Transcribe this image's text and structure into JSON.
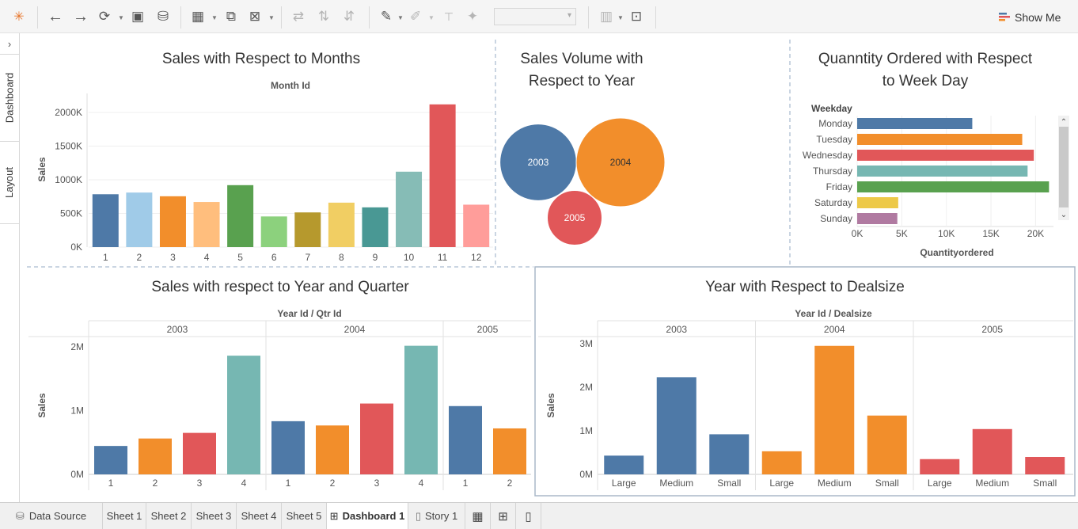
{
  "toolbar": {
    "show_me_label": "Show Me",
    "icons": [
      "tableau-logo-icon",
      "undo-icon",
      "redo-icon",
      "replay-icon",
      "save-icon",
      "new-data-source-icon",
      "new-worksheet-icon",
      "duplicate-icon",
      "clear-sheet-icon",
      "swap-icon",
      "sort-ascending-icon",
      "sort-descending-icon",
      "highlight-icon",
      "annotate-icon",
      "text-label-icon",
      "pin-icon",
      "fit-icon",
      "presentation-icon"
    ]
  },
  "sidebar": {
    "tabs": [
      "Dashboard",
      "Layout"
    ]
  },
  "bottom_tabs": [
    {
      "label": "Data Source",
      "icon": "database-icon"
    },
    {
      "label": "Sheet 1"
    },
    {
      "label": "Sheet 2"
    },
    {
      "label": "Sheet 3"
    },
    {
      "label": "Sheet 4"
    },
    {
      "label": "Sheet 5"
    },
    {
      "label": "Dashboard 1",
      "icon": "dashboard-icon",
      "active": true
    },
    {
      "label": "Story 1",
      "icon": "story-icon"
    }
  ],
  "chart_data": [
    {
      "type": "bar",
      "title": "Sales with Respect to Months",
      "header": "Month Id",
      "ylabel": "Sales",
      "categories": [
        "1",
        "2",
        "3",
        "4",
        "5",
        "6",
        "7",
        "8",
        "9",
        "10",
        "11",
        "12"
      ],
      "values": [
        785000,
        810000,
        755000,
        670000,
        920000,
        455000,
        515000,
        660000,
        590000,
        1120000,
        2120000,
        630000
      ],
      "yticks": [
        {
          "v": 0,
          "label": "0K"
        },
        {
          "v": 500000,
          "label": "500K"
        },
        {
          "v": 1000000,
          "label": "1000K"
        },
        {
          "v": 1500000,
          "label": "1500K"
        },
        {
          "v": 2000000,
          "label": "2000K"
        }
      ],
      "ylim": [
        0,
        2200000
      ],
      "colors": [
        "#4e79a7",
        "#a0cbe8",
        "#f28e2b",
        "#ffbe7d",
        "#59a14f",
        "#8cd17d",
        "#b6992d",
        "#f1ce63",
        "#499894",
        "#86bcb6",
        "#e15759",
        "#ff9d9a"
      ]
    },
    {
      "type": "bubble",
      "title": "Sales Volume  with",
      "title2": "Respect to Year",
      "bubbles": [
        {
          "label": "2003",
          "value": 3520000,
          "color": "#4e79a7"
        },
        {
          "label": "2004",
          "value": 4720000,
          "color": "#f28e2b"
        },
        {
          "label": "2005",
          "value": 1790000,
          "color": "#e15759"
        }
      ]
    },
    {
      "type": "bar",
      "orientation": "horizontal",
      "title": "Quanntity Ordered with Respect",
      "title2": "to Week Day",
      "row_header": "Weekday",
      "xlabel": "Quantityordered",
      "categories": [
        "Monday",
        "Tuesday",
        "Wednesday",
        "Thursday",
        "Friday",
        "Saturday",
        "Sunday"
      ],
      "values": [
        12900,
        18500,
        19800,
        19100,
        21500,
        4600,
        4500
      ],
      "xticks": [
        {
          "v": 0,
          "label": "0K"
        },
        {
          "v": 5000,
          "label": "5K"
        },
        {
          "v": 10000,
          "label": "10K"
        },
        {
          "v": 15000,
          "label": "15K"
        },
        {
          "v": 20000,
          "label": "20K"
        }
      ],
      "xlim": [
        0,
        22000
      ],
      "colors": [
        "#4e79a7",
        "#f28e2b",
        "#e15759",
        "#76b7b2",
        "#59a14f",
        "#edc948",
        "#b07aa1"
      ]
    },
    {
      "type": "bar",
      "title": "Sales with respect to Year and Quarter",
      "header": "Year Id / Qtr Id",
      "ylabel": "Sales",
      "groups": [
        {
          "label": "2003",
          "categories": [
            "1",
            "2",
            "3",
            "4"
          ],
          "values": [
            445000,
            562000,
            650000,
            1860000
          ]
        },
        {
          "label": "2004",
          "categories": [
            "1",
            "2",
            "3",
            "4"
          ],
          "values": [
            833000,
            766000,
            1110000,
            2015000
          ]
        },
        {
          "label": "2005",
          "categories": [
            "1",
            "2"
          ],
          "values": [
            1070000,
            720000
          ]
        }
      ],
      "yticks": [
        {
          "v": 0,
          "label": "0M"
        },
        {
          "v": 1000000,
          "label": "1M"
        },
        {
          "v": 2000000,
          "label": "2M"
        }
      ],
      "ylim": [
        0,
        2060000
      ],
      "colors": [
        "#4e79a7",
        "#f28e2b",
        "#e15759",
        "#76b7b2"
      ]
    },
    {
      "type": "bar",
      "title": "Year with Respect to Dealsize",
      "header": "Year Id / Dealsize",
      "ylabel": "Sales",
      "groups": [
        {
          "label": "2003",
          "categories": [
            "Large",
            "Medium",
            "Small"
          ],
          "values": [
            430000,
            2230000,
            920000
          ],
          "color": "#4e79a7"
        },
        {
          "label": "2004",
          "categories": [
            "Large",
            "Medium",
            "Small"
          ],
          "values": [
            530000,
            2950000,
            1350000
          ],
          "color": "#f28e2b"
        },
        {
          "label": "2005",
          "categories": [
            "Large",
            "Medium",
            "Small"
          ],
          "values": [
            350000,
            1040000,
            400000
          ],
          "color": "#e15759"
        }
      ],
      "yticks": [
        {
          "v": 0,
          "label": "0M"
        },
        {
          "v": 1000000,
          "label": "1M"
        },
        {
          "v": 2000000,
          "label": "2M"
        },
        {
          "v": 3000000,
          "label": "3M"
        }
      ],
      "ylim": [
        0,
        3000000
      ]
    }
  ]
}
